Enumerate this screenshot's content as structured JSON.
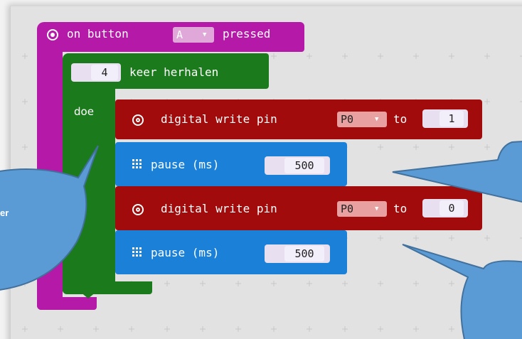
{
  "hat_block": {
    "prefix": "on button",
    "button_value": "A",
    "suffix": "pressed"
  },
  "repeat_block": {
    "count": "4",
    "label": "keer herhalen",
    "do_label": "doe"
  },
  "blocks": [
    {
      "type": "digital_write",
      "label": "digital write pin",
      "pin": "P0",
      "to_label": "to",
      "value": "1"
    },
    {
      "type": "pause",
      "label": "pause (ms)",
      "value": "500"
    },
    {
      "type": "digital_write",
      "label": "digital write pin",
      "pin": "P0",
      "to_label": "to",
      "value": "0"
    },
    {
      "type": "pause",
      "label": "pause (ms)",
      "value": "500"
    }
  ],
  "callouts": {
    "left_text_fragment": "er"
  },
  "colors": {
    "hat": "#b419a8",
    "loop": "#1b7a1b",
    "digital_write": "#a10b0b",
    "pause": "#1a80d8",
    "callout": "#5b9bd5"
  }
}
